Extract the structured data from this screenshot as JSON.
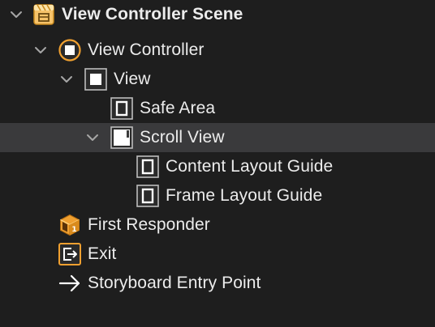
{
  "outline": {
    "items": [
      {
        "label": "View Controller Scene",
        "icon": "scene-icon",
        "expanded": true
      },
      {
        "label": "View Controller",
        "icon": "view-controller-icon",
        "expanded": true
      },
      {
        "label": "View",
        "icon": "view-icon",
        "expanded": true
      },
      {
        "label": "Safe Area",
        "icon": "layout-guide-icon"
      },
      {
        "label": "Scroll View",
        "icon": "scroll-view-icon",
        "expanded": true,
        "selected": true
      },
      {
        "label": "Content Layout Guide",
        "icon": "layout-guide-icon"
      },
      {
        "label": "Frame Layout Guide",
        "icon": "layout-guide-icon"
      },
      {
        "label": "First Responder",
        "icon": "first-responder-icon"
      },
      {
        "label": "Exit",
        "icon": "exit-icon"
      },
      {
        "label": "Storyboard Entry Point",
        "icon": "arrow-right-icon"
      }
    ]
  },
  "colors": {
    "background": "#1e1e1e",
    "selection": "#3a3a3c",
    "text": "#ececec",
    "chevron": "#a6a6a6",
    "accent_orange": "#f0a030"
  }
}
